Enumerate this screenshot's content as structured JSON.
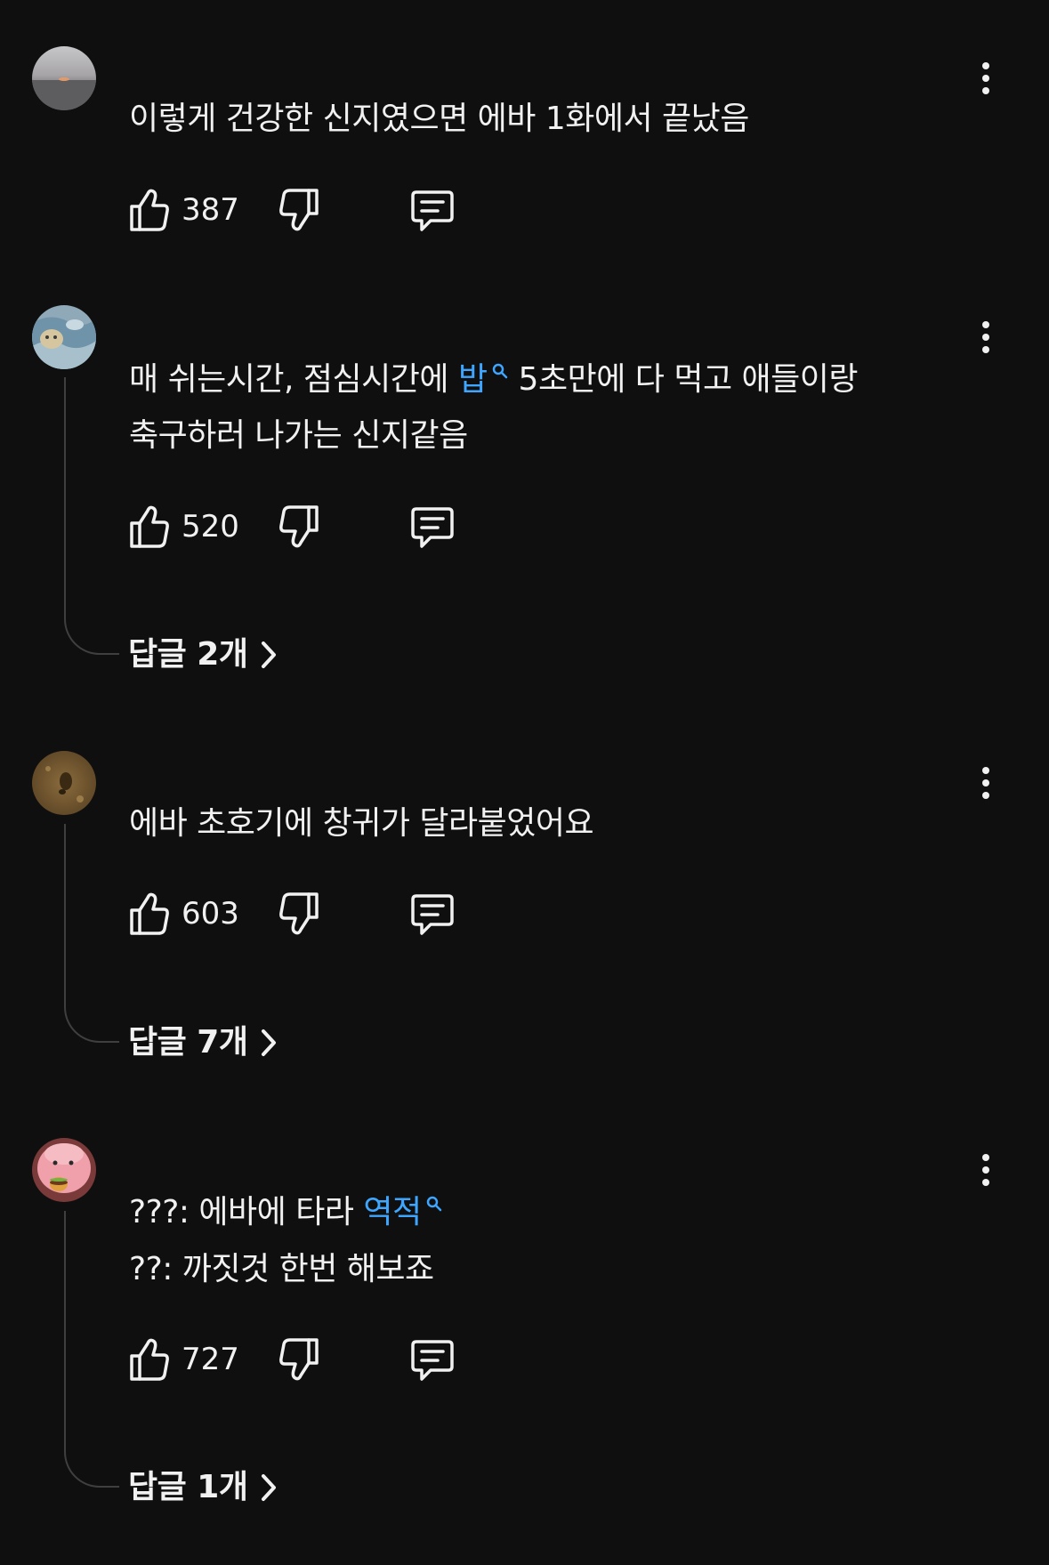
{
  "comments": [
    {
      "lines": [
        {
          "parts": [
            {
              "text": "이렇게 건강한 신지였으면 에바 1화에서 끝났음",
              "link": false
            }
          ]
        }
      ],
      "likes": "387",
      "replies_label": ""
    },
    {
      "lines": [
        {
          "parts": [
            {
              "text": "매 쉬는시간, 점심시간에 ",
              "link": false
            },
            {
              "text": "밥",
              "link": true
            },
            {
              "text": " 5초만에 다 먹고 애들이랑",
              "link": false
            }
          ]
        },
        {
          "parts": [
            {
              "text": "축구하러 나가는 신지같음",
              "link": false
            }
          ]
        }
      ],
      "likes": "520",
      "replies_label": "답글 2개"
    },
    {
      "lines": [
        {
          "parts": [
            {
              "text": "에바 초호기에 창귀가 달라붙었어요",
              "link": false
            }
          ]
        }
      ],
      "likes": "603",
      "replies_label": "답글 7개"
    },
    {
      "lines": [
        {
          "parts": [
            {
              "text": "???: 에바에 타라 ",
              "link": false
            },
            {
              "text": "역적",
              "link": true
            }
          ]
        },
        {
          "parts": [
            {
              "text": "??: 까짓것 한번 해보죠",
              "link": false
            }
          ]
        }
      ],
      "likes": "727",
      "replies_label": "답글 1개"
    }
  ],
  "icons": {
    "like": "thumbs-up-icon",
    "dislike": "thumbs-down-icon",
    "reply": "comment-reply-icon",
    "more": "more-vertical-icon",
    "chevron": "chevron-right-icon",
    "search": "search-icon"
  },
  "colors": {
    "background": "#0f0f0f",
    "text": "#f1f1f1",
    "link": "#3ea6ff",
    "thread_line": "#3f3f3f"
  }
}
